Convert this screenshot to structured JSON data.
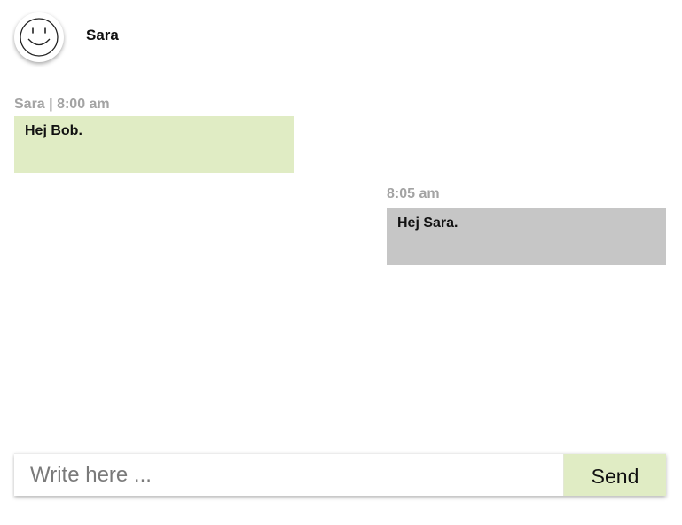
{
  "header": {
    "contact_name": "Sara",
    "avatar_icon": "smiley-face-icon"
  },
  "messages": [
    {
      "meta": "Sara | 8:00 am",
      "text": "Hej Bob.",
      "direction": "incoming",
      "color": "#e0ecc4"
    },
    {
      "meta": "8:05 am",
      "text": "Hej Sara.",
      "direction": "outgoing",
      "color": "#c6c6c6"
    }
  ],
  "composer": {
    "placeholder": "Write here ...",
    "value": "",
    "send_label": "Send",
    "send_color": "#e0ecc4"
  }
}
